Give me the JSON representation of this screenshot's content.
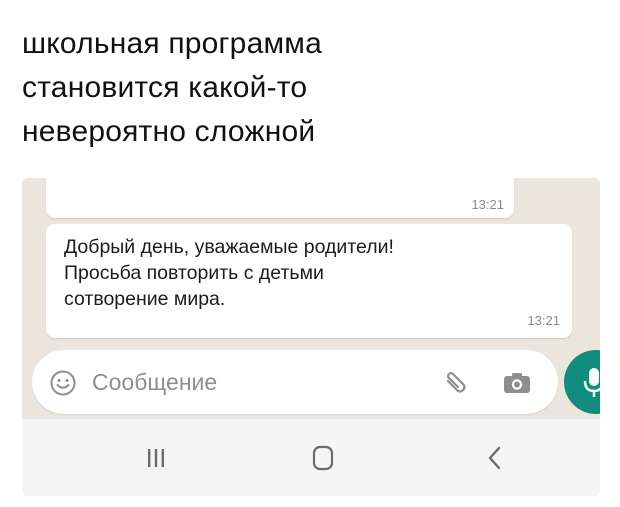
{
  "caption": {
    "lines": [
      "школьная программа",
      "становится какой-то",
      "невероятно сложной"
    ]
  },
  "chat": {
    "previous_message": {
      "time": "13:21"
    },
    "message": {
      "text": "Добрый день, уважаемые родители!\nПросьба повторить с детьми\nсотворение мира.",
      "time": "13:21"
    }
  },
  "input": {
    "placeholder": "Сообщение",
    "icons": [
      "emoji-icon",
      "paperclip-icon",
      "camera-icon"
    ]
  },
  "mic_button": {
    "icon": "microphone-icon",
    "color": "#128c7e"
  },
  "nav_bar": {
    "icons": [
      "recents-icon",
      "home-icon",
      "back-icon"
    ]
  },
  "colors": {
    "chat_background": "#ece5dd",
    "bubble": "#ffffff",
    "accent": "#128c7e"
  }
}
